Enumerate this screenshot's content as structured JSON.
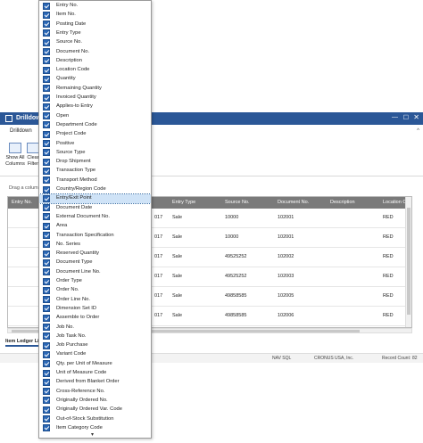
{
  "window": {
    "title": "Drilldown",
    "min_glyph": "—",
    "max_glyph": "☐",
    "close_glyph": "✕"
  },
  "ribbon": {
    "tab_label": "Drilldown",
    "collapse_glyph": "^",
    "buttons": [
      {
        "label": "Show All Columns",
        "icon": "columns-icon"
      },
      {
        "label": "Clear Filter",
        "icon": "clear-filter-icon"
      }
    ],
    "clear_filter_visible": "Clea\nFilte"
  },
  "grid": {
    "drag_hint": "Drag a colum",
    "headers": [
      "Entry No.",
      "Entry Type",
      "Source No.",
      "Document No.",
      "Description",
      "Location Co"
    ],
    "rows": [
      {
        "date": "017",
        "type": "Sale",
        "source": "10000",
        "doc": "102001",
        "desc": "",
        "loc": "RED"
      },
      {
        "date": "017",
        "type": "Sale",
        "source": "10000",
        "doc": "102001",
        "desc": "",
        "loc": "RED"
      },
      {
        "date": "017",
        "type": "Sale",
        "source": "49525252",
        "doc": "102002",
        "desc": "",
        "loc": "RED"
      },
      {
        "date": "017",
        "type": "Sale",
        "source": "49525252",
        "doc": "102003",
        "desc": "",
        "loc": "RED"
      },
      {
        "date": "017",
        "type": "Sale",
        "source": "49858585",
        "doc": "102005",
        "desc": "",
        "loc": "RED"
      },
      {
        "date": "017",
        "type": "Sale",
        "source": "49858585",
        "doc": "102006",
        "desc": "",
        "loc": "RED"
      }
    ]
  },
  "bottom_tab": "Item Ledger Li",
  "status": {
    "server": "NAV SQL",
    "company": "CRONUS USA, Inc.",
    "record_label": "Record Count:",
    "record_count": "82"
  },
  "dropdown": {
    "items": [
      "Entry No.",
      "Item No.",
      "Posting Date",
      "Entry Type",
      "Source No.",
      "Document No.",
      "Description",
      "Location Code",
      "Quantity",
      "Remaining Quantity",
      "Invoiced Quantity",
      "Applies-to Entry",
      "Open",
      "Department Code",
      "Project Code",
      "Positive",
      "Source Type",
      "Drop Shipment",
      "Transaction Type",
      "Transport Method",
      "Country/Region Code",
      "Entry/Exit Point",
      "Document Date",
      "External Document No.",
      "Area",
      "Transaction Specification",
      "No. Series",
      "Reserved Quantity",
      "Document Type",
      "Document Line No.",
      "Order Type",
      "Order No.",
      "Order Line No.",
      "Dimension Set ID",
      "Assemble to Order",
      "Job No.",
      "Job Task No.",
      "Job Purchase",
      "Variant Code",
      "Qty. per Unit of Measure",
      "Unit of Measure Code",
      "Derived from Blanket Order",
      "Cross-Reference No.",
      "Originally Ordered No.",
      "Originally Ordered Var. Code",
      "Out-of-Stock Substitution",
      "Item Category Code"
    ],
    "selected_index": 21,
    "more_glyph": "▾"
  }
}
